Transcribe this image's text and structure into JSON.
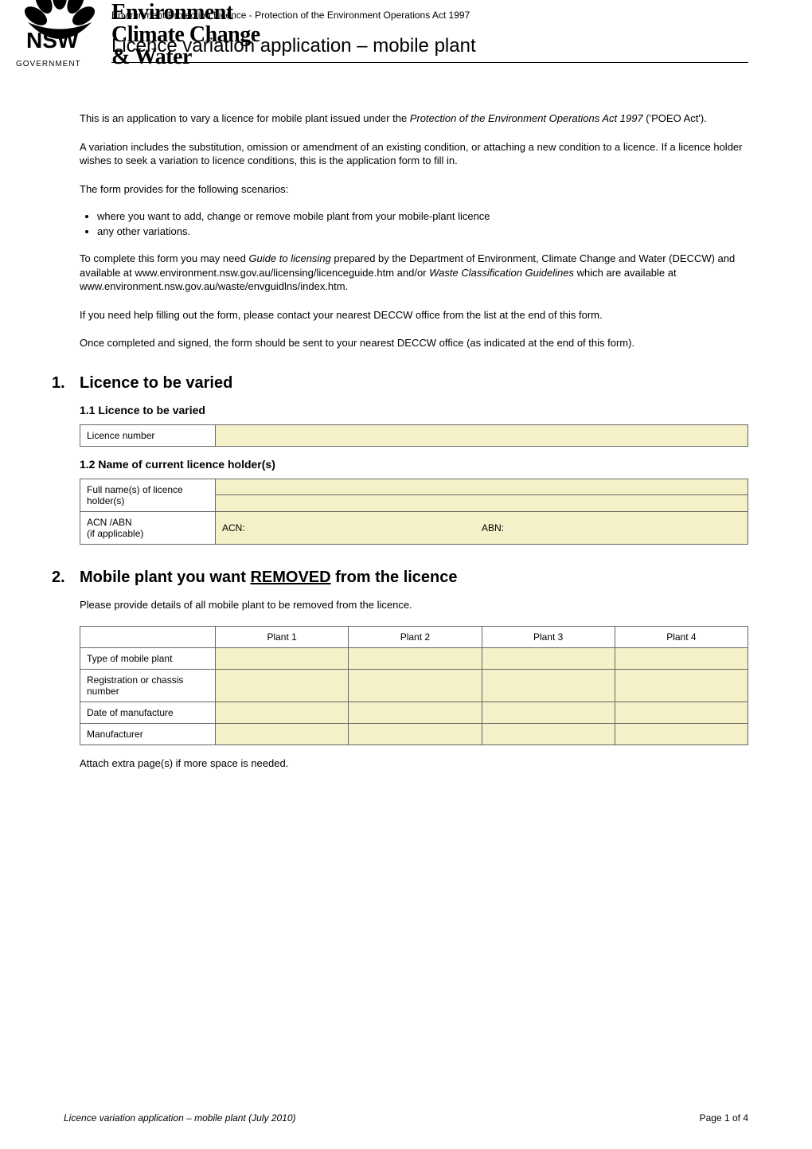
{
  "header": {
    "brand_line1": "Environment",
    "brand_line2": "Climate Change",
    "brand_line3": "& Water",
    "state_abbrev": "NSW",
    "government": "GOVERNMENT",
    "act_prefix": "Environment Protection Licence - ",
    "act_title": "Protection of the Environment Operations Act 1997",
    "page_title": "Licence variation application – mobile plant"
  },
  "intro": {
    "p1_a": "This is an application to vary a licence for mobile plant issued under the ",
    "p1_ital": "Protection of the Environment Operations Act 1997",
    "p1_b": " ('POEO Act').",
    "p2": "A variation includes the substitution, omission or amendment of an existing condition, or attaching a new condition to a licence. If a licence holder wishes to seek a variation to licence conditions, this is the application form to fill in.",
    "p3": "The form provides for the following scenarios:",
    "bullets": [
      "where you want to add, change or remove mobile plant from your mobile-plant licence",
      "any other variations."
    ],
    "p4_a": "To complete this form you may need ",
    "p4_ital1": "Guide to licensing",
    "p4_b": " prepared by the Department of Environment, Climate Change and Water (DECCW) and available at www.environment.nsw.gov.au/licensing/licenceguide.htm and/or ",
    "p4_ital2": "Waste Classification Guidelines",
    "p4_c": " which are available at www.environment.nsw.gov.au/waste/envguidlns/index.htm.",
    "p5": "If you need help filling out the form, please contact your nearest DECCW office from the list at the end of this form.",
    "p6": "Once completed and signed, the form should be sent to your nearest DECCW office (as indicated at the end of this form)."
  },
  "section1": {
    "num": "1.",
    "title": "Licence to be varied",
    "sub1": {
      "heading": "1.1  Licence to be varied",
      "row_label": "Licence number",
      "value": ""
    },
    "sub2": {
      "heading": "1.2  Name of current licence holder(s)",
      "row1_label": "Full name(s) of licence holder(s)",
      "row1_value_a": "",
      "row1_value_b": "",
      "row2_label": "ACN /ABN\n(if applicable)",
      "acn_label": "ACN:",
      "acn_value": "",
      "abn_label": "ABN:",
      "abn_value": ""
    }
  },
  "section2": {
    "num": "2.",
    "title_a": "Mobile plant you want ",
    "title_under": "REMOVED",
    "title_b": " from the licence",
    "lead": "Please provide details of all mobile plant to be removed from the licence.",
    "headers": [
      "Plant 1",
      "Plant 2",
      "Plant 3",
      "Plant 4"
    ],
    "rows": [
      {
        "label": "Type of mobile plant",
        "cells": [
          "",
          "",
          "",
          ""
        ]
      },
      {
        "label": "Registration or chassis number",
        "cells": [
          "",
          "",
          "",
          ""
        ]
      },
      {
        "label": "Date of manufacture",
        "cells": [
          "",
          "",
          "",
          ""
        ]
      },
      {
        "label": "Manufacturer",
        "cells": [
          "",
          "",
          "",
          ""
        ]
      }
    ],
    "attach_note": "Attach extra page(s) if more space is needed."
  },
  "footer": {
    "left": "Licence variation application – mobile plant (July 2010)",
    "right": "Page 1 of 4"
  }
}
